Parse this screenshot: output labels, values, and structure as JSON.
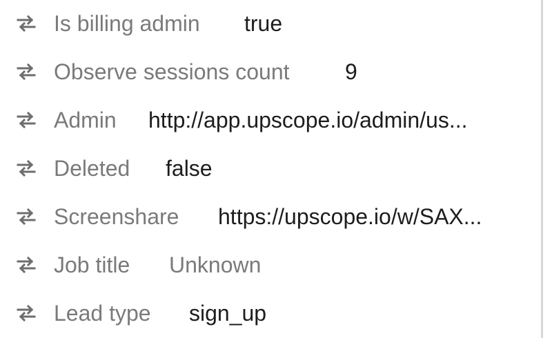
{
  "attributes": [
    {
      "label": "Is billing admin",
      "value": "true"
    },
    {
      "label": "Observe sessions count",
      "value": "9"
    },
    {
      "label": "Admin",
      "value": "http://app.upscope.io/admin/us..."
    },
    {
      "label": "Deleted",
      "value": "false"
    },
    {
      "label": "Screenshare",
      "value": "https://upscope.io/w/SAX..."
    },
    {
      "label": "Job title",
      "value": "Unknown"
    },
    {
      "label": "Lead type",
      "value": "sign_up"
    }
  ],
  "icon": "swap-arrows-icon",
  "colors": {
    "label": "#7a7a7a",
    "value": "#1d1d1d",
    "muted_value": "#7a7a7a",
    "icon": "#6d6d6d",
    "border": "#d6d6d6"
  }
}
